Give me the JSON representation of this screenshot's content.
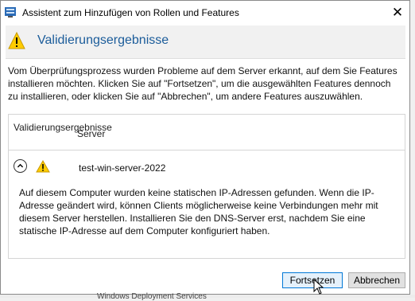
{
  "window": {
    "title": "Assistent zum Hinzufügen von Rollen und Features",
    "close_label": "✕"
  },
  "header": {
    "title": "Validierungsergebnisse"
  },
  "description": "Vom Überprüfungsprozess wurden Probleme auf dem Server erkannt, auf dem Sie Features installieren möchten. Klicken Sie auf \"Fortsetzen\", um die ausgewählten Features dennoch zu installieren, oder klicken Sie auf \"Abbrechen\", um andere Features auszuwählen.",
  "table": {
    "columns": [
      "Validierungsergebnisse",
      "Server"
    ],
    "rows": [
      {
        "server": "test-win-server-2022",
        "status": "warning",
        "expanded": true,
        "message": "Auf diesem Computer wurden keine statischen IP-Adressen gefunden. Wenn die IP-Adresse geändert wird, können Clients möglicherweise keine Verbindungen mehr mit diesem Server herstellen. Installieren Sie den DNS-Server erst, nachdem Sie eine statische IP-Adresse auf dem Computer konfiguriert haben."
      }
    ]
  },
  "buttons": {
    "continue": "Fortsetzen",
    "cancel": "Abbrechen"
  },
  "background": {
    "text": "Windows Deployment Services"
  },
  "colors": {
    "accent": "#1b5c9a",
    "warning": "#ffcc00",
    "focus_border": "#0078d7"
  }
}
